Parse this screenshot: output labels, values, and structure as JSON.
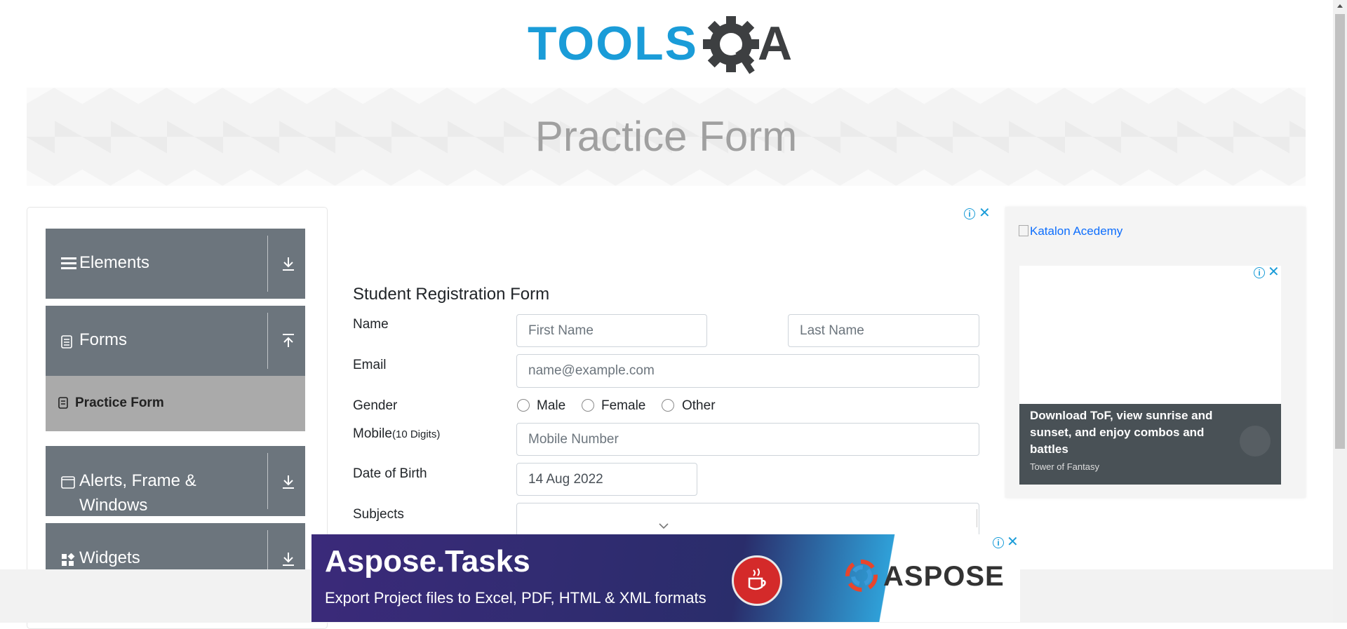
{
  "logo": {
    "text_tools": "TOOLS",
    "text_qa": "QA"
  },
  "banner": {
    "title": "Practice Form"
  },
  "sidebar": {
    "groups": [
      {
        "label": "Elements",
        "icon": "list-icon",
        "arrow": "download-arrow-icon"
      },
      {
        "label": "Forms",
        "icon": "document-icon",
        "arrow": "upload-arrow-icon"
      },
      {
        "label_line1": "Alerts, Frame &",
        "label_line2": "Windows",
        "icon": "window-icon",
        "arrow": "download-arrow-icon"
      },
      {
        "label": "Widgets",
        "icon": "widgets-icon",
        "arrow": "download-arrow-icon"
      }
    ],
    "active_item": {
      "label": "Practice Form",
      "icon": "practice-form-icon"
    }
  },
  "form": {
    "title": "Student Registration Form",
    "name_label": "Name",
    "first_name_placeholder": "First Name",
    "last_name_placeholder": "Last Name",
    "email_label": "Email",
    "email_placeholder": "name@example.com",
    "gender_label": "Gender",
    "gender_options": [
      "Male",
      "Female",
      "Other"
    ],
    "mobile_label": "Mobile",
    "mobile_hint": "(10 Digits)",
    "mobile_placeholder": "Mobile Number",
    "dob_label": "Date of Birth",
    "dob_value": "14 Aug 2022",
    "subjects_label": "Subjects"
  },
  "right_ad": {
    "image_alt": "Katalon Acedemy",
    "promo_title": "Download ToF, view sunrise and sunset, and enjoy combos and battles",
    "promo_source": "Tower of Fantasy"
  },
  "bottom_ad": {
    "title": "Aspose.Tasks",
    "subtitle": "Export Project files to Excel, PDF, HTML & XML formats",
    "brand": "ASPOSE"
  },
  "colors": {
    "sidebar_group": "#6c757d",
    "active_item": "#aaaaaa",
    "logo_blue": "#1a9cd8",
    "logo_dark": "#3d3f41",
    "ad_info": "#1a9cd8"
  }
}
